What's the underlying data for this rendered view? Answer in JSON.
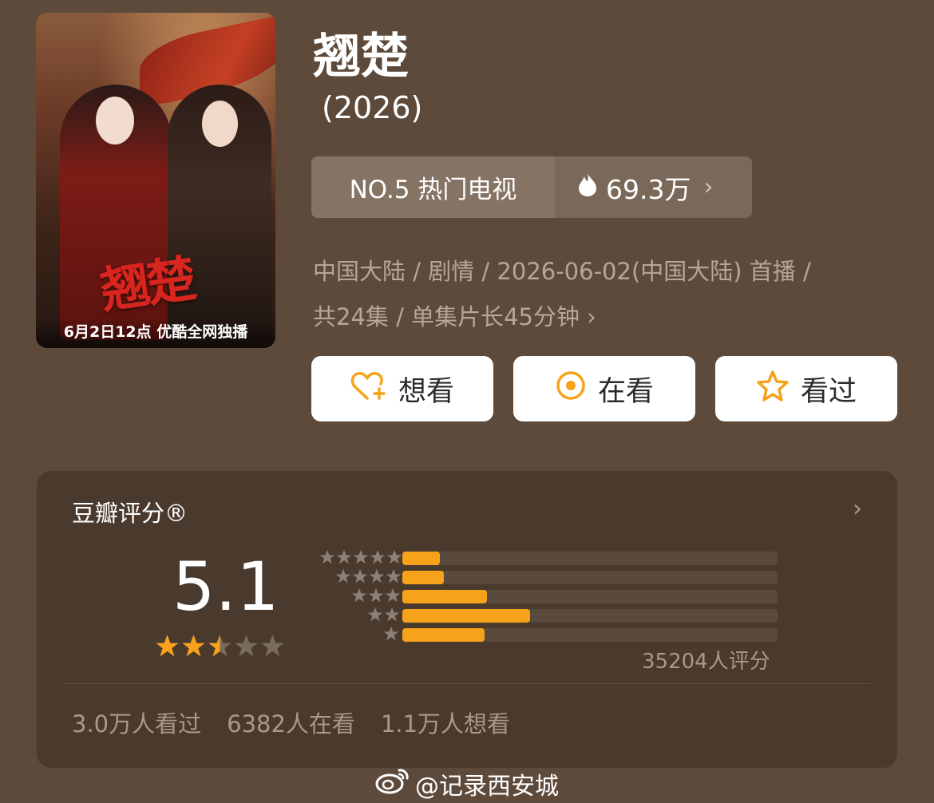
{
  "poster": {
    "calligraphy": "翘楚",
    "caption": "6月2日12点 优酷全网独播"
  },
  "title": "翘楚",
  "year": "(2026)",
  "rank": {
    "label": "NO.5 热门电视",
    "heat": "69.3万",
    "heat_icon": "flame-icon",
    "chevron": "›"
  },
  "meta": {
    "line1": "中国大陆 / 剧情 / 2026-06-02(中国大陆) 首播 /",
    "line2": "共24集 / 单集片长45分钟",
    "chevron": "›"
  },
  "actions": {
    "want": "想看",
    "watching": "在看",
    "watched": "看过"
  },
  "colors": {
    "accent": "#f6a21a",
    "background": "#5e4a3a",
    "card": "#4a3a2e"
  },
  "rating": {
    "header": "豆瓣评分®",
    "chevron": "›",
    "score": "5.1",
    "stars_value": 2.5,
    "stars_max": 5,
    "distribution": [
      {
        "stars": 5,
        "fraction": 0.1
      },
      {
        "stars": 4,
        "fraction": 0.11
      },
      {
        "stars": 3,
        "fraction": 0.225
      },
      {
        "stars": 2,
        "fraction": 0.34
      },
      {
        "stars": 1,
        "fraction": 0.22
      }
    ],
    "count": "35204人评分",
    "stats": {
      "watched": "3.0万人看过",
      "watching": "6382人在看",
      "want": "1.1万人想看"
    }
  },
  "watermark": "@记录西安城"
}
